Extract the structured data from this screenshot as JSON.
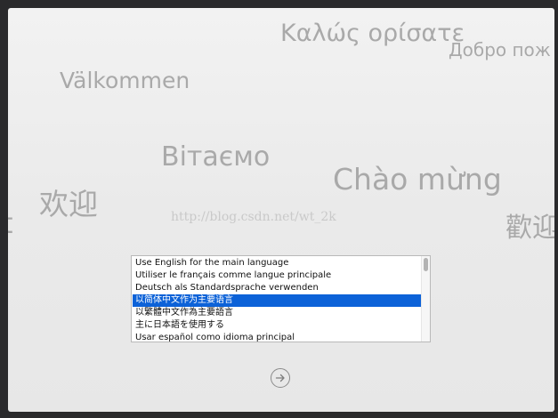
{
  "greetings": {
    "greek": "Καλώς ορίσατε",
    "russian": "Добро пож",
    "swedish": "Välkommen",
    "ukrainian": "Вітаємо",
    "vietnamese": "Chào mừng",
    "chinese_simplified": "欢迎",
    "chinese_traditional": "歡迎",
    "partial_left": "t"
  },
  "watermark": "http://blog.csdn.net/wt_2k",
  "language_list": {
    "items": [
      "Use English for the main language",
      "Utiliser le français comme langue principale",
      "Deutsch als Standardsprache verwenden",
      "以简体中文作为主要语言",
      "以繁體中文作為主要語言",
      "主に日本語を使用する",
      "Usar español como idioma principal"
    ],
    "selected_index": 3
  },
  "next_button": {
    "icon": "arrow-right-circle-icon"
  },
  "colors": {
    "selection": "#0c62d8",
    "greeting_text": "#a9a9a9"
  }
}
